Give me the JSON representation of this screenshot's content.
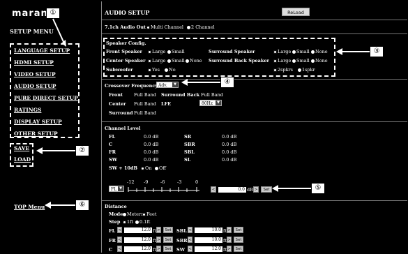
{
  "brand": "marantz",
  "sidebar": {
    "title": "SETUP MENU",
    "menu_items": [
      "LANGUAGE SETUP",
      "HDMI SETUP",
      "VIDEO SETUP",
      "AUDIO SETUP",
      "PURE DIRECT SETUP",
      "RATINGS",
      "DISPLAY SETUP",
      "OTHER SETUP"
    ],
    "save": "SAVE",
    "load": "LOAD",
    "top_menu": "TOP Menu"
  },
  "header": {
    "title": "AUDIO SETUP",
    "reload": "ReLoad"
  },
  "audio_out": {
    "label": "7.1ch Audio Out",
    "opt1": "Multi Channel",
    "opt2": "2 Channel"
  },
  "speaker_config": {
    "title": "Speaker Config.",
    "front": "Front Speaker",
    "center": "Center Speaker",
    "sub": "Subwoofer",
    "surround": "Surround Speaker",
    "surround_back": "Surround Back Speaker",
    "large": "Large",
    "small": "Small",
    "none": "None",
    "yes": "Yes",
    "no": "No",
    "two_spkrs": "2spkrs",
    "one_spkr": "1spkr"
  },
  "crossover": {
    "label": "Crossover Frequency",
    "value": "Adv.",
    "front": "Front",
    "center": "Center",
    "surround": "Surround",
    "surround_back": "Surround Back",
    "lfe": "LFE",
    "full_band": "Full Band",
    "lfe_value": "80Hz"
  },
  "channel_level": {
    "title": "Channel Level",
    "left": [
      {
        "ch": "FL",
        "val": "0.0 dB"
      },
      {
        "ch": "C",
        "val": "0.0 dB"
      },
      {
        "ch": "FR",
        "val": "0.0 dB"
      },
      {
        "ch": "SW",
        "val": "0.0 dB"
      }
    ],
    "right": [
      {
        "ch": "SR",
        "val": "0.0 dB"
      },
      {
        "ch": "SBR",
        "val": "0.0 dB"
      },
      {
        "ch": "SBL",
        "val": "0.0 dB"
      },
      {
        "ch": "SL",
        "val": "0.0 dB"
      }
    ],
    "sw10": "SW + 10dB",
    "on": "On",
    "off": "Off",
    "channel_select": "FL",
    "tick_labels": [
      "-12",
      "-9",
      "-6",
      "-3",
      "0"
    ],
    "level_value": "0.0",
    "unit": "dB",
    "set": "Set"
  },
  "distance": {
    "title": "Distance",
    "mode_label": "Mode",
    "meters": "Meters",
    "feet": "Feet",
    "step_label": "Step",
    "step1": "1ft",
    "step2": "0.1ft",
    "rows": [
      {
        "l": "FL",
        "lv": "12.0",
        "r": "SBL",
        "rv": "10.0"
      },
      {
        "l": "FR",
        "lv": "12.0",
        "r": "SBR",
        "rv": "10.0"
      },
      {
        "l": "C",
        "lv": "12.0",
        "r": "SW",
        "rv": "12.0"
      }
    ],
    "ft": "ft",
    "set": "Set"
  },
  "callouts": [
    "①",
    "②",
    "③",
    "④",
    "⑤",
    "⑥"
  ]
}
